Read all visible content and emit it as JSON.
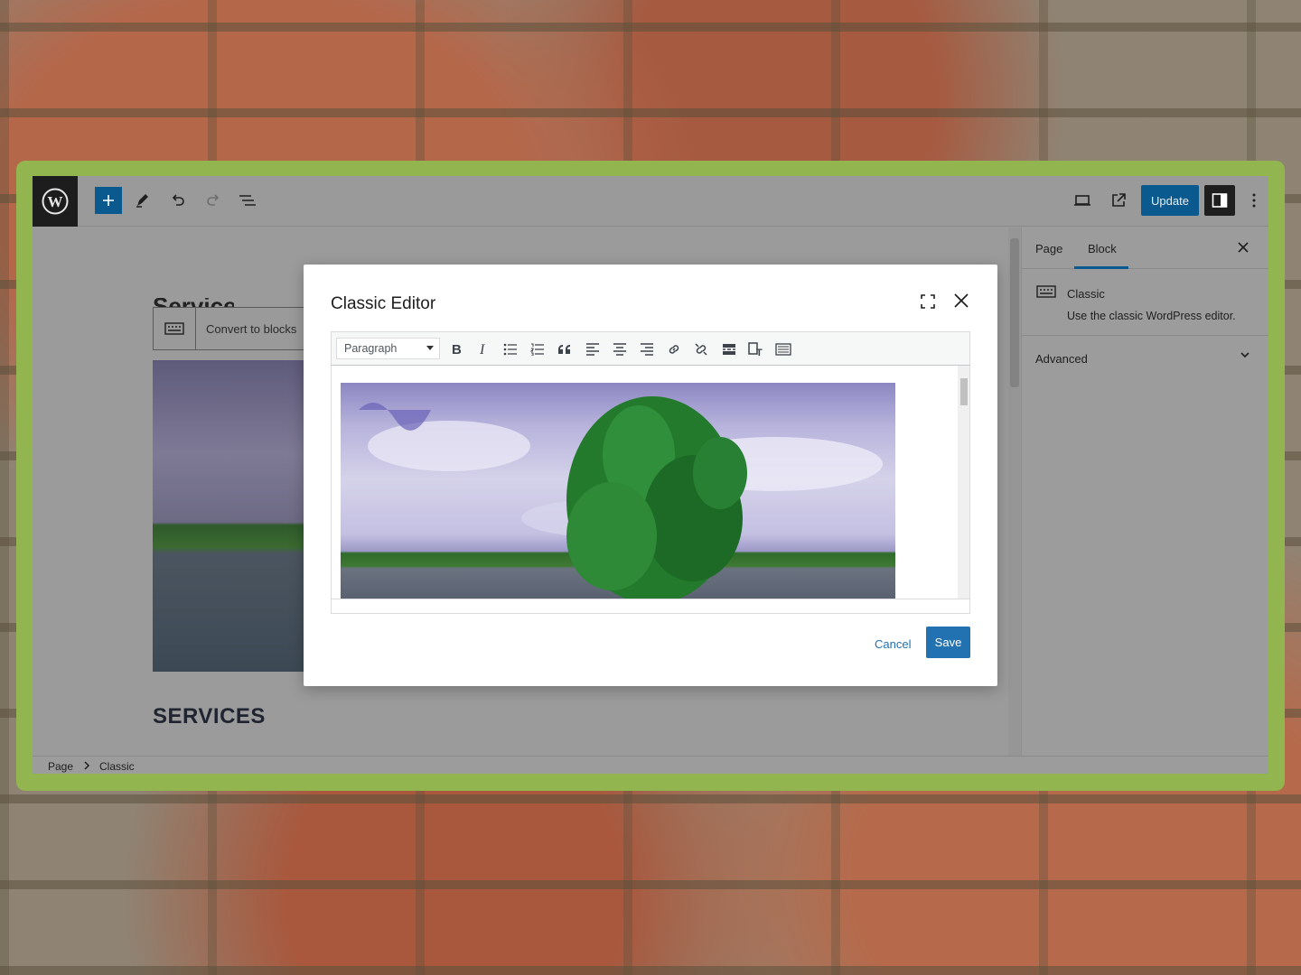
{
  "topbar": {
    "update_label": "Update",
    "icons": [
      "wordpress-logo",
      "plus-icon",
      "pencil-icon",
      "undo-icon",
      "redo-icon",
      "list-view-icon",
      "desktop-preview-icon",
      "external-link-icon",
      "settings-panel-icon",
      "more-vertical-icon"
    ]
  },
  "canvas": {
    "block_toolbar": {
      "convert_label": "Convert to blocks"
    },
    "heading_fragment": "Services",
    "services_heading": "SERVICES"
  },
  "sidebar": {
    "tabs": [
      "Page",
      "Block"
    ],
    "active_tab": "Block",
    "block_title": "Classic",
    "block_description": "Use the classic WordPress editor.",
    "advanced_label": "Advanced"
  },
  "footer": {
    "breadcrumb": [
      "Page",
      "Classic"
    ]
  },
  "modal": {
    "title": "Classic Editor",
    "format_value": "Paragraph",
    "toolbar_buttons": [
      "bold",
      "italic",
      "bulleted-list",
      "numbered-list",
      "blockquote",
      "align-left",
      "align-center",
      "align-right",
      "link",
      "unlink",
      "read-more",
      "paste-as-text",
      "toolbar-toggle"
    ],
    "cancel_label": "Cancel",
    "save_label": "Save"
  },
  "colors": {
    "accent": "#2271b1",
    "frame": "#93b54f",
    "overlay": "#9b9b9b"
  }
}
